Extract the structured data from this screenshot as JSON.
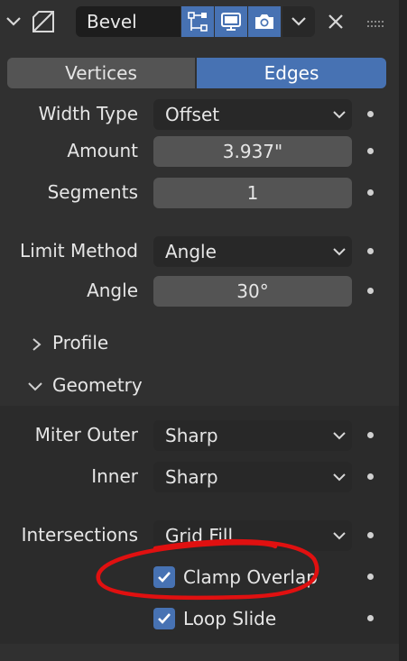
{
  "modifier": {
    "name": "Bevel",
    "icons": [
      "chevron-down-icon",
      "bevel-modifier-icon",
      "edit-mode-icon",
      "realtime-viewport-icon",
      "render-camera-icon",
      "dropdown-chevron-icon",
      "close-icon",
      "drag-grip-icon"
    ]
  },
  "affect": {
    "options": [
      "Vertices",
      "Edges"
    ],
    "selected": "Edges"
  },
  "fields": {
    "width_type": {
      "label": "Width Type",
      "value": "Offset"
    },
    "amount": {
      "label": "Amount",
      "value": "3.937\""
    },
    "segments": {
      "label": "Segments",
      "value": "1"
    },
    "limit_method": {
      "label": "Limit Method",
      "value": "Angle"
    },
    "angle": {
      "label": "Angle",
      "value": "30°"
    }
  },
  "subpanels": {
    "profile": {
      "label": "Profile",
      "expanded": false
    },
    "geometry": {
      "label": "Geometry",
      "expanded": true
    }
  },
  "geometry": {
    "miter_outer": {
      "label": "Miter Outer",
      "value": "Sharp"
    },
    "inner": {
      "label": "Inner",
      "value": "Sharp"
    },
    "intersections": {
      "label": "Intersections",
      "value": "Grid Fill"
    },
    "clamp_overlap": {
      "label": "Clamp Overlap",
      "checked": true
    },
    "loop_slide": {
      "label": "Loop Slide",
      "checked": true
    }
  },
  "colors": {
    "accent": "#4772b3",
    "background": "#303030",
    "annotation": "#e01010"
  }
}
